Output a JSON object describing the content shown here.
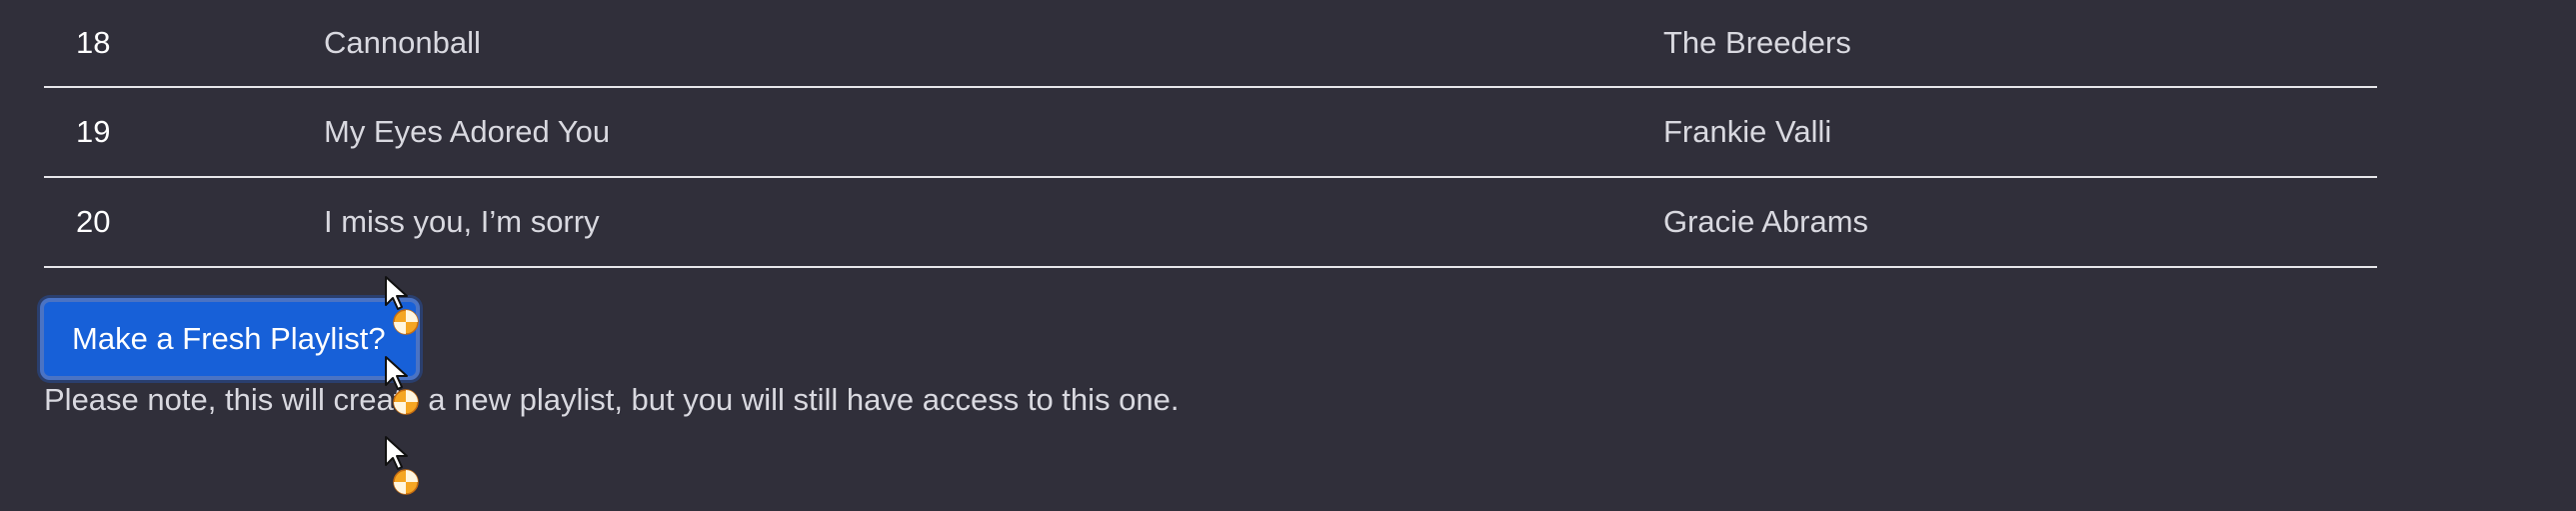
{
  "tracks": [
    {
      "num": "18",
      "title": "Cannonball",
      "artist": "The Breeders"
    },
    {
      "num": "19",
      "title": "My Eyes Adored You",
      "artist": "Frankie Valli"
    },
    {
      "num": "20",
      "title": "I miss you, I’m sorry",
      "artist": "Gracie Abrams"
    }
  ],
  "fresh_button_label": "Make a Fresh Playlist?",
  "note_text": "Please note, this will create a new playlist, but you will still have access to this one.",
  "colors": {
    "background": "#302f3a",
    "button": "#1760d8",
    "divider": "#e6e6ea",
    "cursor_badge": "#f5a623"
  },
  "icons": [
    "cursor-arrow-icon",
    "cursor-busy-badge-icon"
  ]
}
